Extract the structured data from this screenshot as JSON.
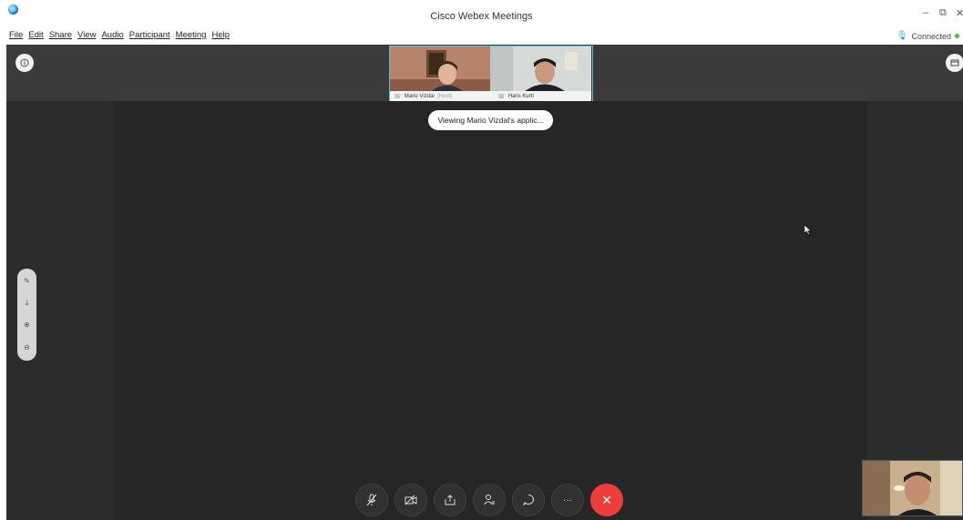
{
  "window": {
    "title": "Cisco Webex Meetings",
    "minimize": "–",
    "restore": "⧉",
    "close": "✕"
  },
  "menu": {
    "items": [
      "File",
      "Edit",
      "Share",
      "View",
      "Audio",
      "Participant",
      "Meeting",
      "Help"
    ],
    "connection_status": "Connected"
  },
  "participants": [
    {
      "name": "Mario Vizdal",
      "role": "(Host)"
    },
    {
      "name": "Haris Kurti"
    }
  ],
  "toast": {
    "text": "Viewing Mario Vizdal's applic..."
  },
  "controls": {
    "more_label": "···",
    "end_label": "✕"
  },
  "icons": {
    "info": "info-icon",
    "layout": "layout-icon",
    "annotate": "annotate-icon",
    "fit": "fit-icon",
    "zoom_in": "zoom-in-icon",
    "zoom_out": "zoom-out-icon"
  },
  "colors": {
    "end_button": "#ee3e39",
    "video_border": "#4fc1d9",
    "connected_dot": "#3fbf4e"
  }
}
